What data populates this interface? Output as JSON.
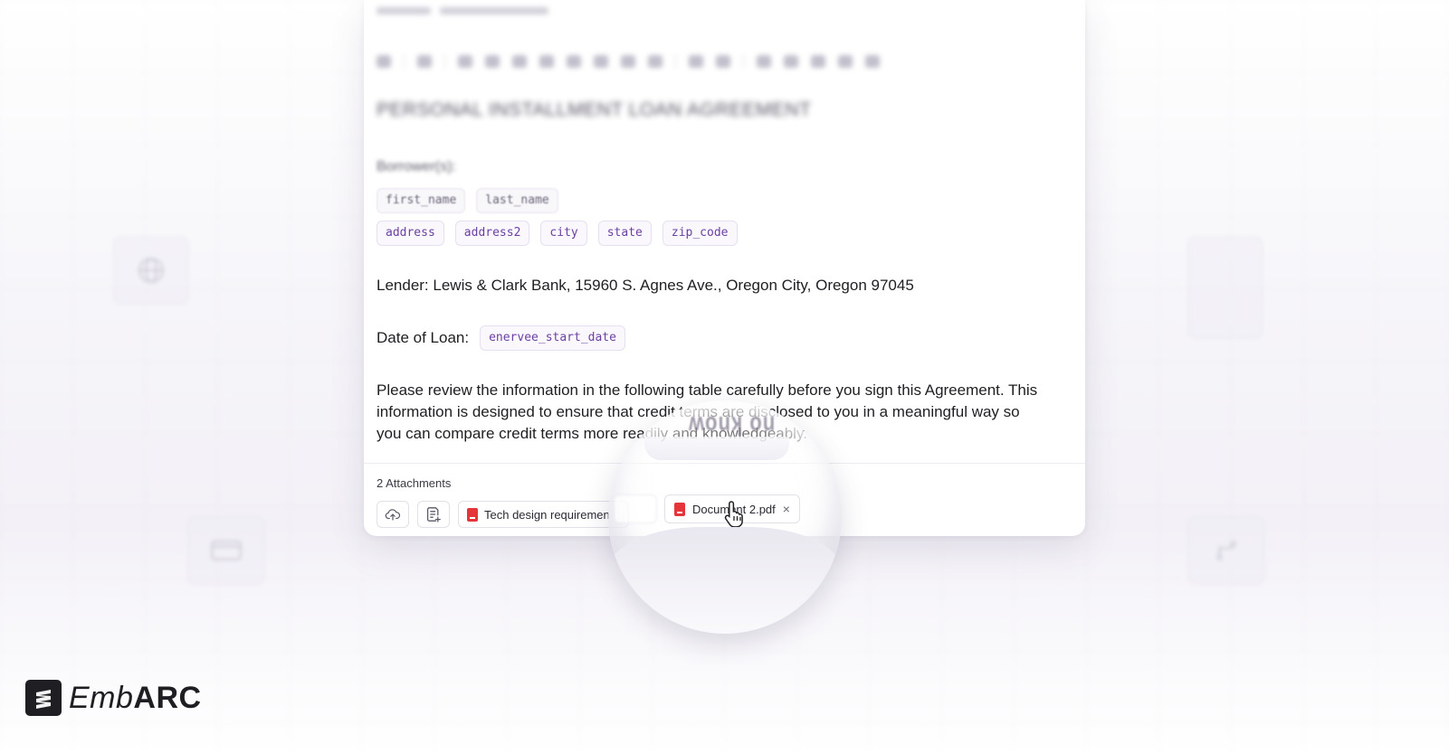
{
  "document": {
    "title": "PERSONAL INSTALLMENT LOAN AGREEMENT",
    "borrower_label": "Borrower(s):",
    "borrower_fields_row1": [
      "first_name",
      "last_name"
    ],
    "borrower_fields_row2": [
      "address",
      "address2",
      "city",
      "state",
      "zip_code"
    ],
    "lender_line": "Lender: Lewis & Clark Bank, 15960 S. Agnes Ave., Oregon City, Oregon 97045",
    "date_label": "Date of Loan:",
    "date_field": "enervee_start_date",
    "paragraph_line1": "Please review the information in the following table carefully before you sign this Agreement. This",
    "paragraph_line2": "information is designed to ensure that credit terms are disclosed to you in a meaningful way so",
    "paragraph_line3": "you can compare credit terms more readily and knowledgeably."
  },
  "attachments": {
    "label": "2 Attachments",
    "upload_icon": "cloud-upload-icon",
    "add_doc_icon": "document-add-icon",
    "files": [
      {
        "name": "Tech design requiremen",
        "icon": "pdf-file-icon"
      },
      {
        "name": "Document 2.pdf",
        "icon": "pdf-file-icon"
      }
    ]
  },
  "magnifier": {
    "top_text": "no know",
    "file_name": "Document 2.pdf",
    "close_symbol": "×"
  },
  "brand": {
    "name_light": "Emb",
    "name_bold": "ARC",
    "icon": "embarc-logo-icon"
  },
  "colors": {
    "chip_text": "#6b3fa0",
    "pdf_red": "#e5343a",
    "text": "#1f1f23"
  }
}
